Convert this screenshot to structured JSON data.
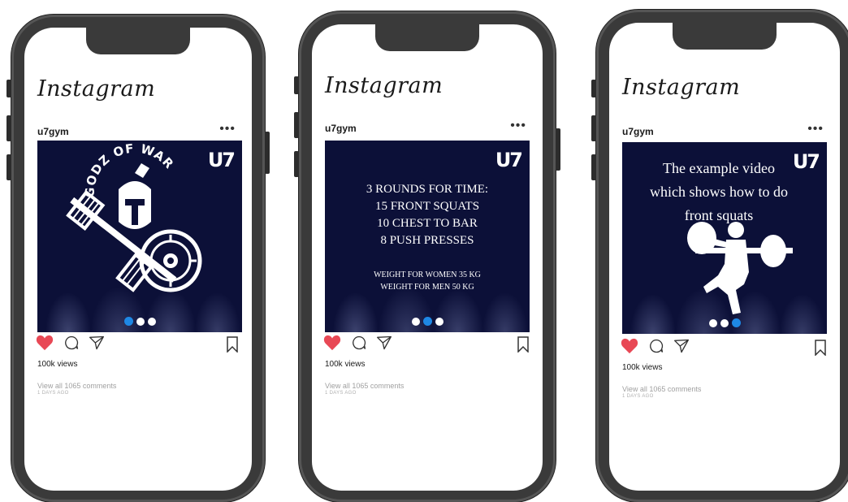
{
  "app_name": "Instagram",
  "colors": {
    "post_background": "#0c1038",
    "like": "#e84855",
    "dot_active": "#1e88e5",
    "phone_frame": "#3a3a3a"
  },
  "posts": [
    {
      "username": "u7gym",
      "brand_mark": "U7",
      "logo_text": "GODZ OF WAR",
      "lines": [],
      "sub_lines": [],
      "views": "100k views",
      "comments": "View all 1065 comments",
      "time_ago": "1 DAYS AGO",
      "carousel_active": 0,
      "icons": [
        "heart-icon",
        "comment-icon",
        "share-icon",
        "bookmark-icon"
      ]
    },
    {
      "username": "u7gym",
      "brand_mark": "U7",
      "lines": [
        "3 ROUNDS FOR TIME:",
        "15 FRONT SQUATS",
        "10 CHEST TO BAR",
        "8 PUSH PRESSES"
      ],
      "sub_lines": [
        "WEIGHT FOR WOMEN 35 KG",
        "WEIGHT FOR MEN 50 KG"
      ],
      "views": "100k views",
      "comments": "View all 1065 comments",
      "time_ago": "1 DAYS AGO",
      "carousel_active": 1,
      "icons": [
        "heart-icon",
        "comment-icon",
        "share-icon",
        "bookmark-icon"
      ]
    },
    {
      "username": "u7gym",
      "brand_mark": "U7",
      "lines": [
        "The example video",
        "which shows how to do",
        "front squats"
      ],
      "sub_lines": [],
      "views": "100k views",
      "comments": "View all 1065 comments",
      "time_ago": "1 DAYS AGO",
      "carousel_active": 2,
      "icons": [
        "heart-icon",
        "comment-icon",
        "share-icon",
        "bookmark-icon"
      ]
    }
  ]
}
